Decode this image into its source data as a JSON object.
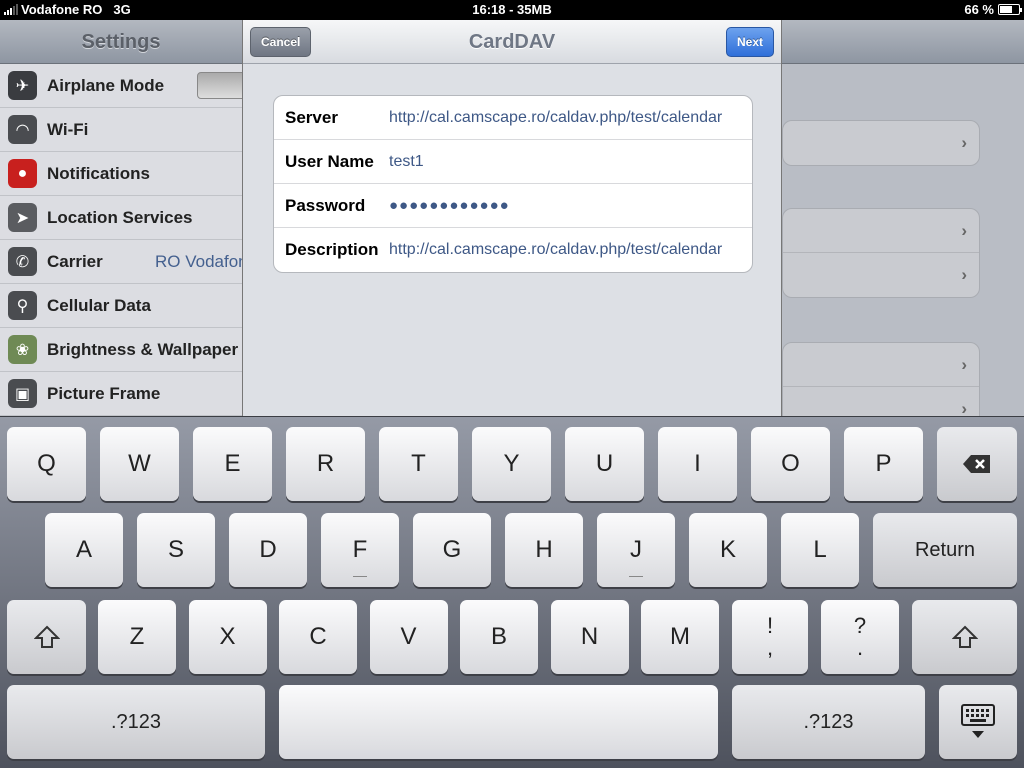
{
  "status": {
    "carrier": "Vodafone RO",
    "network": "3G",
    "center": "16:18 - 35MB",
    "battery": "66 %",
    "battery_level": 0.66
  },
  "settings": {
    "title": "Settings",
    "items": [
      {
        "label": "Airplane Mode",
        "icon": "airplane-icon",
        "value": ""
      },
      {
        "label": "Wi-Fi",
        "icon": "wifi-icon",
        "value": ""
      },
      {
        "label": "Notifications",
        "icon": "notifications-icon",
        "value": ""
      },
      {
        "label": "Location Services",
        "icon": "location-icon",
        "value": ""
      },
      {
        "label": "Carrier",
        "icon": "phone-icon",
        "value": "RO Vodafon"
      },
      {
        "label": "Cellular Data",
        "icon": "antenna-icon",
        "value": ""
      },
      {
        "label": "Brightness & Wallpaper",
        "icon": "flower-icon",
        "value": ""
      },
      {
        "label": "Picture Frame",
        "icon": "picture-frame-icon",
        "value": ""
      }
    ]
  },
  "modal": {
    "title": "CardDAV",
    "cancel_label": "Cancel",
    "next_label": "Next",
    "fields": [
      {
        "label": "Server",
        "value": "http://cal.camscape.ro/caldav.php/test/calendar"
      },
      {
        "label": "User Name",
        "value": "test1"
      },
      {
        "label": "Password",
        "value": "●●●●●●●●●●●●"
      },
      {
        "label": "Description",
        "value": "http://cal.camscape.ro/caldav.php/test/calendar"
      }
    ]
  },
  "keyboard": {
    "row1": [
      "Q",
      "W",
      "E",
      "R",
      "T",
      "Y",
      "U",
      "I",
      "O",
      "P"
    ],
    "row2": [
      "A",
      "S",
      "D",
      "F",
      "G",
      "H",
      "J",
      "K",
      "L"
    ],
    "row3": [
      "Z",
      "X",
      "C",
      "V",
      "B",
      "N",
      "M"
    ],
    "return_label": "Return",
    "numbers_label": ".?123",
    "punct1_top": "!",
    "punct1_bottom": ",",
    "punct2_top": "?",
    "punct2_bottom": "."
  },
  "colors": {
    "next_button": "#3b7be0",
    "value_text": "#3e5886"
  }
}
